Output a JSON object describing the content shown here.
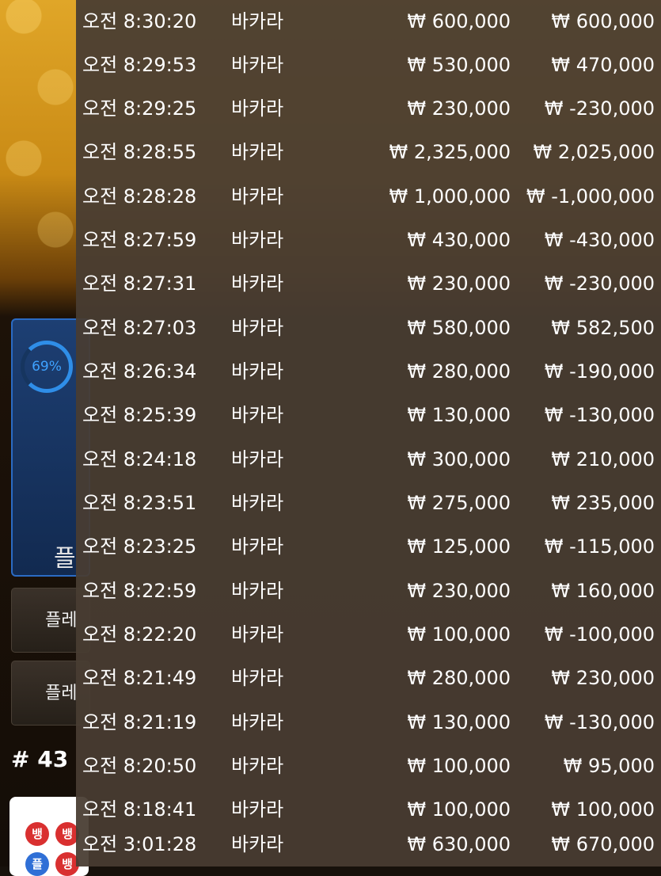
{
  "background": {
    "progress_percent": "69%",
    "player_label": "플",
    "bet_buttons": [
      "플레",
      "플레"
    ],
    "round_number": "# 43",
    "road_marks": [
      "뱅",
      "뱅",
      "플",
      "뱅"
    ]
  },
  "history": {
    "rows": [
      {
        "time": "오전 8:30:20",
        "game": "바카라",
        "bet": "₩ 600,000",
        "win": "₩ 600,000"
      },
      {
        "time": "오전 8:29:53",
        "game": "바카라",
        "bet": "₩ 530,000",
        "win": "₩ 470,000"
      },
      {
        "time": "오전 8:29:25",
        "game": "바카라",
        "bet": "₩ 230,000",
        "win": "₩ -230,000"
      },
      {
        "time": "오전 8:28:55",
        "game": "바카라",
        "bet": "₩ 2,325,000",
        "win": "₩ 2,025,000"
      },
      {
        "time": "오전 8:28:28",
        "game": "바카라",
        "bet": "₩ 1,000,000",
        "win": "₩ -1,000,000"
      },
      {
        "time": "오전 8:27:59",
        "game": "바카라",
        "bet": "₩ 430,000",
        "win": "₩ -430,000"
      },
      {
        "time": "오전 8:27:31",
        "game": "바카라",
        "bet": "₩ 230,000",
        "win": "₩ -230,000"
      },
      {
        "time": "오전 8:27:03",
        "game": "바카라",
        "bet": "₩ 580,000",
        "win": "₩ 582,500"
      },
      {
        "time": "오전 8:26:34",
        "game": "바카라",
        "bet": "₩ 280,000",
        "win": "₩ -190,000"
      },
      {
        "time": "오전 8:25:39",
        "game": "바카라",
        "bet": "₩ 130,000",
        "win": "₩ -130,000"
      },
      {
        "time": "오전 8:24:18",
        "game": "바카라",
        "bet": "₩ 300,000",
        "win": "₩ 210,000"
      },
      {
        "time": "오전 8:23:51",
        "game": "바카라",
        "bet": "₩ 275,000",
        "win": "₩ 235,000"
      },
      {
        "time": "오전 8:23:25",
        "game": "바카라",
        "bet": "₩ 125,000",
        "win": "₩ -115,000"
      },
      {
        "time": "오전 8:22:59",
        "game": "바카라",
        "bet": "₩ 230,000",
        "win": "₩ 160,000"
      },
      {
        "time": "오전 8:22:20",
        "game": "바카라",
        "bet": "₩ 100,000",
        "win": "₩ -100,000"
      },
      {
        "time": "오전 8:21:49",
        "game": "바카라",
        "bet": "₩ 280,000",
        "win": "₩ 230,000"
      },
      {
        "time": "오전 8:21:19",
        "game": "바카라",
        "bet": "₩ 130,000",
        "win": "₩ -130,000"
      },
      {
        "time": "오전 8:20:50",
        "game": "바카라",
        "bet": "₩ 100,000",
        "win": "₩ 95,000"
      },
      {
        "time": "오전 8:18:41",
        "game": "바카라",
        "bet": "₩ 100,000",
        "win": "₩ 100,000"
      },
      {
        "time": "오전 3:01:28",
        "game": "바카라",
        "bet": "₩ 630,000",
        "win": "₩ 670,000"
      }
    ]
  }
}
